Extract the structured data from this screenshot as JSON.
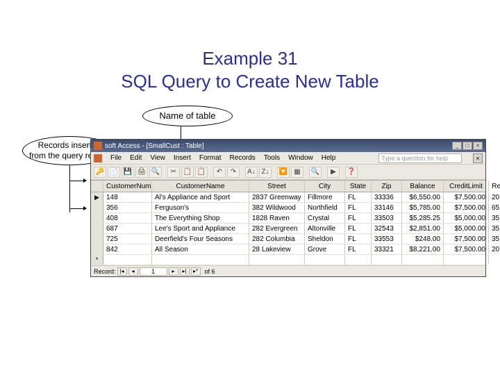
{
  "title": {
    "line1": "Example 31",
    "line2": "SQL Query to Create New Table"
  },
  "callouts": {
    "top": "Name of table",
    "left_l1": "Records inserted",
    "left_l2": "from the query results"
  },
  "window": {
    "title": "soft Access - [SmallCust : Table]",
    "help_prompt": "Type a question for help",
    "menus": [
      "File",
      "Edit",
      "View",
      "Insert",
      "Format",
      "Records",
      "Tools",
      "Window",
      "Help"
    ],
    "toolbar_icons": [
      "🔑",
      "📄",
      "💾",
      "🖨",
      "🔍",
      "",
      "✂",
      "📋",
      "📋",
      "",
      "↶",
      "↷",
      "",
      "A↓",
      "Z↓",
      "",
      "🔽",
      "▦",
      "",
      "🔍",
      "",
      "▶",
      "",
      "❓"
    ],
    "columns": [
      "",
      "CustomerNum",
      "CustomerName",
      "Street",
      "City",
      "State",
      "Zip",
      "Balance",
      "CreditLimit",
      "RepNum"
    ],
    "rows": [
      {
        "sel": "▶",
        "num": "148",
        "name": "Al's Appliance and Sport",
        "street": "2837 Greenway",
        "city": "Fillmore",
        "state": "FL",
        "zip": "33336",
        "balance": "$6,550.00",
        "credit": "$7,500.00",
        "rep": "20"
      },
      {
        "sel": "",
        "num": "356",
        "name": "Ferguson's",
        "street": "382 Wildwood",
        "city": "Northfield",
        "state": "FL",
        "zip": "33146",
        "balance": "$5,785.00",
        "credit": "$7,500.00",
        "rep": "65"
      },
      {
        "sel": "",
        "num": "408",
        "name": "The Everything Shop",
        "street": "1828 Raven",
        "city": "Crystal",
        "state": "FL",
        "zip": "33503",
        "balance": "$5,285.25",
        "credit": "$5,000.00",
        "rep": "35"
      },
      {
        "sel": "",
        "num": "687",
        "name": "Lee's Sport and Appliance",
        "street": "282 Evergreen",
        "city": "Altonville",
        "state": "FL",
        "zip": "32543",
        "balance": "$2,851.00",
        "credit": "$5,000.00",
        "rep": "35"
      },
      {
        "sel": "",
        "num": "725",
        "name": "Deerfield's Four Seasons",
        "street": "282 Columbia",
        "city": "Sheldon",
        "state": "FL",
        "zip": "33553",
        "balance": "$248.00",
        "credit": "$7,500.00",
        "rep": "35"
      },
      {
        "sel": "",
        "num": "842",
        "name": "All Season",
        "street": "28 Lakeview",
        "city": "Grove",
        "state": "FL",
        "zip": "33321",
        "balance": "$8,221.00",
        "credit": "$7,500.00",
        "rep": "20"
      }
    ],
    "blank_row_sel": "*",
    "nav": {
      "label": "Record:",
      "first": "|◂",
      "prev": "◂",
      "current": "1",
      "next": "▸",
      "last": "▸|",
      "new": "▸*",
      "of": "of 6"
    }
  }
}
